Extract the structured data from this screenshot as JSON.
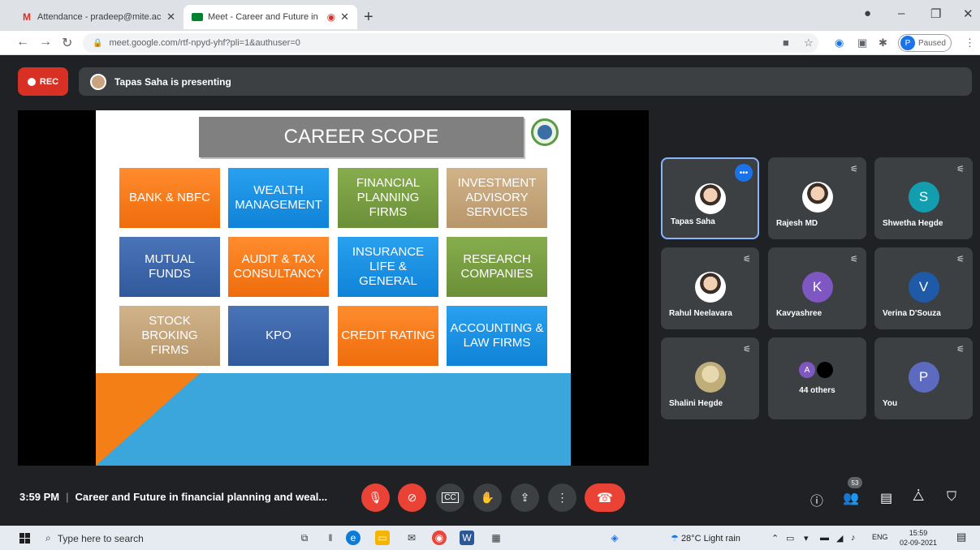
{
  "browser": {
    "tabs": [
      {
        "title": "Attendance - pradeep@mite.ac.i",
        "favicon": "gmail-icon"
      },
      {
        "title": "Meet - Career and Future in",
        "favicon": "meet-icon",
        "recording": true
      }
    ],
    "url": "meet.google.com/rtf-npyd-yhf?pli=1&authuser=0",
    "profile_initial": "P",
    "profile_status": "Paused"
  },
  "meet": {
    "rec_label": "REC",
    "presenting_text": "Tapas Saha is presenting",
    "slide": {
      "title": "CAREER SCOPE",
      "boxes": [
        {
          "label": "BANK & NBFC",
          "color": "orange"
        },
        {
          "label": "WEALTH MANAGEMENT",
          "color": "blue"
        },
        {
          "label": "FINANCIAL PLANNING FIRMS",
          "color": "green"
        },
        {
          "label": "INVESTMENT ADVISORY SERVICES",
          "color": "tan"
        },
        {
          "label": "MUTUAL FUNDS",
          "color": "navy"
        },
        {
          "label": "AUDIT & TAX CONSULTANCY",
          "color": "orange"
        },
        {
          "label": "INSURANCE LIFE & GENERAL",
          "color": "blue"
        },
        {
          "label": "RESEARCH COMPANIES",
          "color": "green"
        },
        {
          "label": "STOCK BROKING FIRMS",
          "color": "tan"
        },
        {
          "label": "KPO",
          "color": "navy"
        },
        {
          "label": "CREDIT RATING",
          "color": "orange"
        },
        {
          "label": "ACCOUNTING & LAW FIRMS",
          "color": "blue"
        }
      ]
    },
    "participants": [
      {
        "name": "Tapas Saha",
        "avatar": "photo",
        "speaking": true
      },
      {
        "name": "Rajesh MD",
        "avatar": "photo",
        "muted": true
      },
      {
        "name": "Shwetha Hegde",
        "initial": "S",
        "color": "#129eaf",
        "muted": true
      },
      {
        "name": "Rahul Neelavara",
        "avatar": "photo",
        "muted": true
      },
      {
        "name": "Kavyashree",
        "initial": "K",
        "color": "#7e57c2",
        "muted": true
      },
      {
        "name": "Verina D'Souza",
        "initial": "V",
        "color": "#1e5aa8",
        "muted": true
      },
      {
        "name": "Shalini Hegde",
        "avatar": "photo",
        "muted": true
      },
      {
        "name": "44 others",
        "initial": "A"
      },
      {
        "name": "You",
        "initial": "P",
        "color": "#5c6bc0",
        "muted": true
      }
    ],
    "time": "3:59 PM",
    "meeting_title": "Career and Future in financial planning and weal...",
    "participant_count": "53"
  },
  "taskbar": {
    "search_placeholder": "Type here to search",
    "weather": "28°C  Light rain",
    "lang": "ENG",
    "time": "15:59",
    "date": "02-09-2021"
  }
}
